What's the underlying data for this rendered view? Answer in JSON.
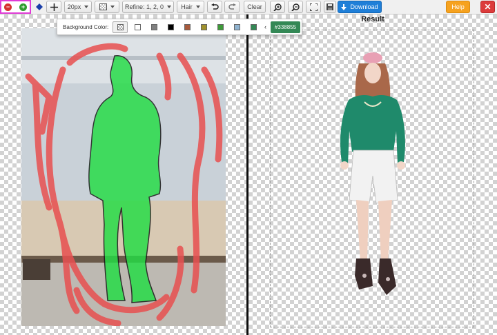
{
  "toolbar": {
    "mode_remove_icon": "minus-circle-icon",
    "mode_keep_icon": "plus-circle-icon",
    "brush_size": "20px",
    "refine_label": "Refine: 1, 2, 0",
    "hair_label": "Hair",
    "clear_label": "Clear",
    "download_label": "Download",
    "help_label": "Help",
    "close_glyph": "✕"
  },
  "background_popup": {
    "label": "Background Color:",
    "swatches": [
      "checker",
      "#ffffff",
      "#808080",
      "#000000",
      "#a85a3c",
      "#a0922c",
      "#3f9a3a",
      "#8fb3d0",
      "#338855"
    ],
    "current_hex": "#338855"
  },
  "result_pane": {
    "title": "Result"
  },
  "colors": {
    "keep_mark": "#22dd44",
    "remove_mark": "#e85050",
    "download_blue": "#1f7fd8",
    "help_orange": "#f6a21f",
    "close_red": "#dc3b3b",
    "highlight_magenta": "#e03ad6"
  }
}
